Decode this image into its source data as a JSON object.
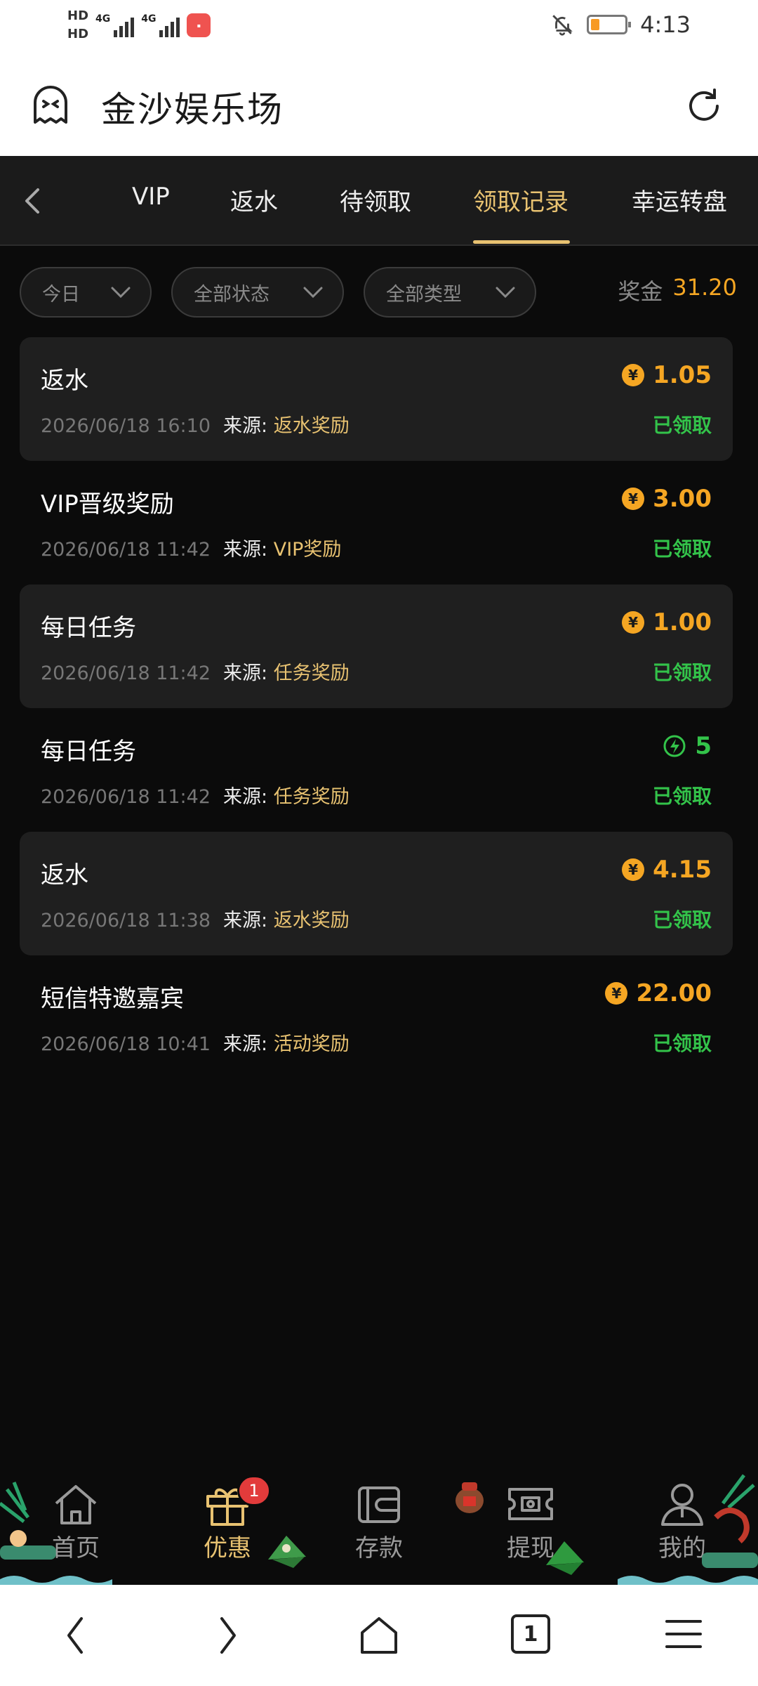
{
  "status_bar": {
    "hd1": "HD",
    "hd2": "HD",
    "net1": "4G",
    "net2": "4G",
    "time": "4:13"
  },
  "browser": {
    "title": "金沙娱乐场"
  },
  "tabs": [
    {
      "label": "VIP",
      "active": false
    },
    {
      "label": "返水",
      "active": false
    },
    {
      "label": "待领取",
      "active": false
    },
    {
      "label": "领取记录",
      "active": true
    },
    {
      "label": "幸运转盘",
      "active": false
    }
  ],
  "filters": {
    "date": "今日",
    "status": "全部状态",
    "type": "全部类型"
  },
  "bonus": {
    "label": "奖金",
    "value": "31.20"
  },
  "records": [
    {
      "title": "返水",
      "time": "2026/06/18 16:10",
      "source_label": "来源:",
      "source": "返水奖励",
      "amount": "1.05",
      "currency_icon": "yuan-coin-icon",
      "status": "已领取"
    },
    {
      "title": "VIP晋级奖励",
      "time": "2026/06/18 11:42",
      "source_label": "来源:",
      "source": "VIP奖励",
      "amount": "3.00",
      "currency_icon": "yuan-coin-icon",
      "status": "已领取"
    },
    {
      "title": "每日任务",
      "time": "2026/06/18 11:42",
      "source_label": "来源:",
      "source": "任务奖励",
      "amount": "1.00",
      "currency_icon": "yuan-coin-icon",
      "status": "已领取"
    },
    {
      "title": "每日任务",
      "time": "2026/06/18 11:42",
      "source_label": "来源:",
      "source": "任务奖励",
      "amount": "5",
      "currency_icon": "lightning-icon",
      "status": "已领取"
    },
    {
      "title": "返水",
      "time": "2026/06/18 11:38",
      "source_label": "来源:",
      "source": "返水奖励",
      "amount": "4.15",
      "currency_icon": "yuan-coin-icon",
      "status": "已领取"
    },
    {
      "title": "短信特邀嘉宾",
      "time": "2026/06/18 10:41",
      "source_label": "来源:",
      "source": "活动奖励",
      "amount": "22.00",
      "currency_icon": "yuan-coin-icon",
      "status": "已领取"
    }
  ],
  "bottom_nav": [
    {
      "label": "首页",
      "icon": "home-icon"
    },
    {
      "label": "优惠",
      "icon": "gift-icon",
      "badge": "1",
      "active": true
    },
    {
      "label": "存款",
      "icon": "wallet-icon"
    },
    {
      "label": "提现",
      "icon": "ticket-icon"
    },
    {
      "label": "我的",
      "icon": "user-icon"
    }
  ],
  "system_nav": {
    "tab_count": "1"
  },
  "colors": {
    "accent_gold": "#e8c271",
    "amount_orange": "#f5a623",
    "status_green": "#33c34a",
    "background": "#0b0b0b"
  }
}
